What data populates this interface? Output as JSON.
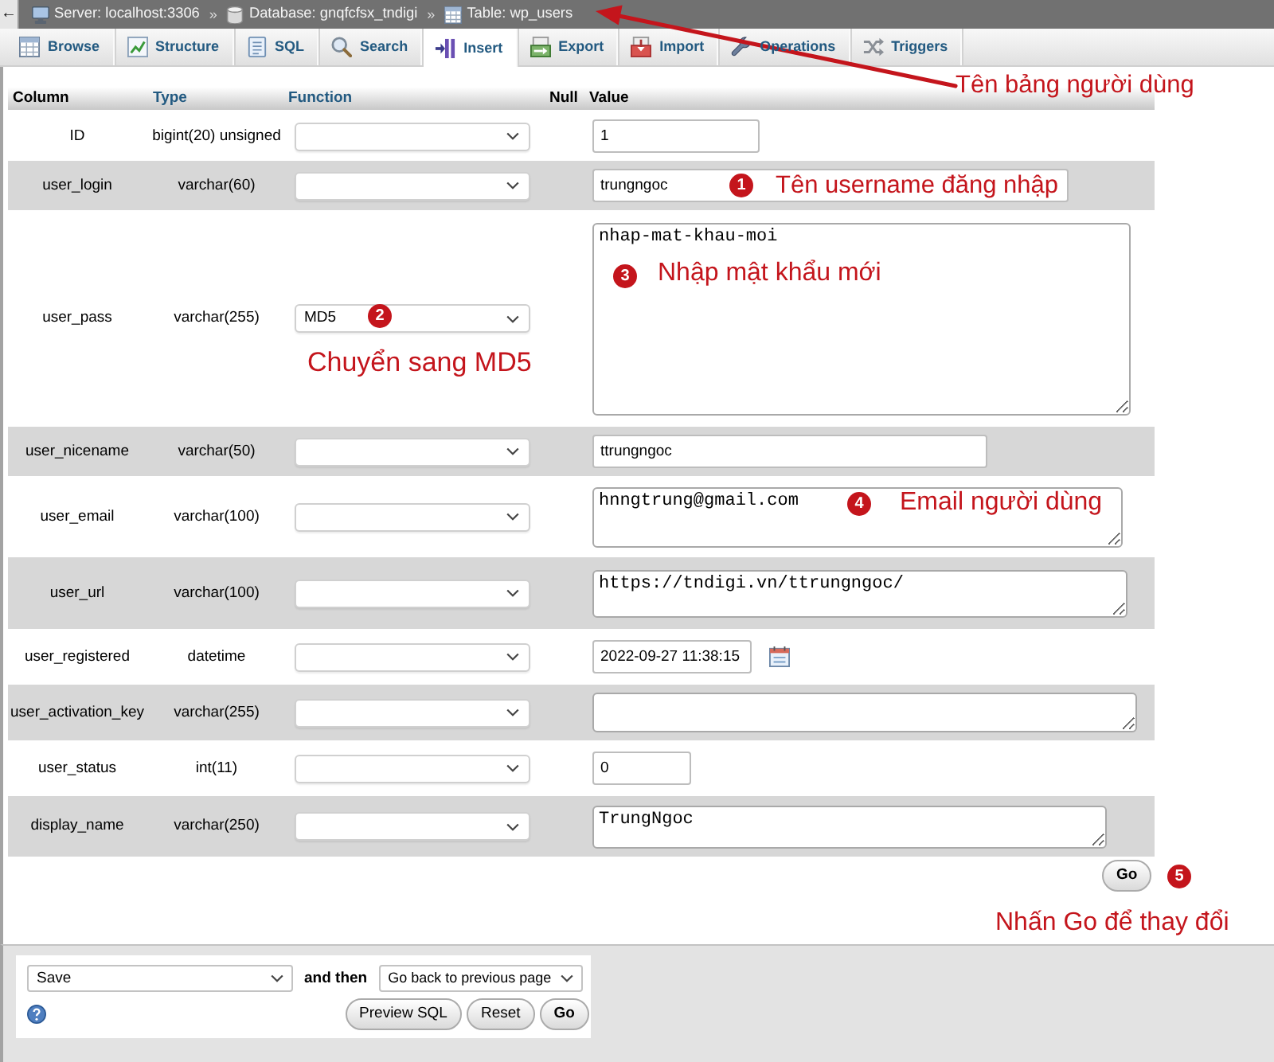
{
  "breadcrumb": {
    "back": "←",
    "items": [
      {
        "kind": "server",
        "text": "Server: localhost:3306"
      },
      {
        "kind": "database",
        "text": "Database: gnqfcfsx_tndigi",
        "separator": "»"
      },
      {
        "kind": "table",
        "text": "Table: wp_users",
        "separator": "»"
      }
    ]
  },
  "table_note": {
    "text": "Tên bảng người dùng"
  },
  "tabs": [
    {
      "kind": "browse",
      "label": "Browse",
      "selected": false
    },
    {
      "kind": "structure",
      "label": "Structure",
      "selected": false
    },
    {
      "kind": "sql",
      "label": "SQL",
      "selected": false
    },
    {
      "kind": "search",
      "label": "Search",
      "selected": false
    },
    {
      "kind": "insert",
      "label": "Insert",
      "selected": true
    },
    {
      "kind": "export",
      "label": "Export",
      "selected": false
    },
    {
      "kind": "import",
      "label": "Import",
      "selected": false
    },
    {
      "kind": "operations",
      "label": "Operations",
      "selected": false
    },
    {
      "kind": "triggers",
      "label": "Triggers",
      "selected": false
    }
  ],
  "insert_form": {
    "columns": [
      {
        "label": "Column",
        "linked": false
      },
      {
        "label": "Type",
        "linked": true
      },
      {
        "label": "Function",
        "linked": true
      },
      {
        "label": "Null",
        "linked": false
      },
      {
        "label": "Value",
        "linked": false
      }
    ],
    "rows": [
      {
        "column": "ID",
        "type": "bigint(20) unsigned",
        "kind": "input",
        "value": "1"
      },
      {
        "column": "user_login",
        "type": "varchar(60)",
        "kind": "input",
        "value": "trungngoc",
        "value_note": {
          "number": "1",
          "text": "Tên username đăng nhập"
        }
      },
      {
        "column": "user_pass",
        "type": "varchar(255)",
        "function": "MD5",
        "function_note": {
          "number": "2",
          "text": "Chuyển sang MD5"
        },
        "kind": "textarea",
        "value": "nhap-mat-khau-moi",
        "value_note": {
          "number": "3",
          "text": "Nhập mật khẩu mới"
        }
      },
      {
        "column": "user_nicename",
        "type": "varchar(50)",
        "kind": "input",
        "value": "ttrungngoc"
      },
      {
        "column": "user_email",
        "type": "varchar(100)",
        "kind": "textarea",
        "value": "hnngtrung@gmail.com",
        "value_note": {
          "number": "4",
          "text": "Email người dùng"
        }
      },
      {
        "column": "user_url",
        "type": "varchar(100)",
        "kind": "textarea",
        "value": "https://tndigi.vn/ttrungngoc/"
      },
      {
        "column": "user_registered",
        "type": "datetime",
        "kind": "datetime",
        "value": "2022-09-27 11:38:15"
      },
      {
        "column": "user_activation_key",
        "type": "varchar(255)",
        "kind": "textarea"
      },
      {
        "column": "user_status",
        "type": "int(11)",
        "kind": "input",
        "value": "0"
      },
      {
        "column": "display_name",
        "type": "varchar(250)",
        "kind": "textarea",
        "value": "TrungNgoc"
      }
    ],
    "go_button": "Go",
    "go_note": {
      "number": "5",
      "text": "Nhấn Go để thay đổi"
    }
  },
  "footer": {
    "action": "Save",
    "and_then": "and then",
    "after": "Go back to previous page",
    "buttons": [
      {
        "label": "Preview SQL",
        "kind": "plain"
      },
      {
        "label": "Reset",
        "kind": "plain"
      },
      {
        "label": "Go",
        "kind": "submit"
      }
    ]
  }
}
